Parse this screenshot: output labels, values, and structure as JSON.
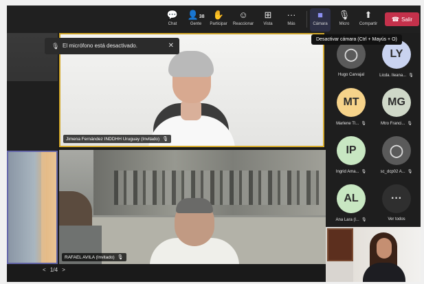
{
  "toolbar": {
    "chat_label": "Chat",
    "people_label": "Gente",
    "people_count": "38",
    "raise_label": "Participar",
    "react_label": "Reaccionar",
    "view_label": "Vista",
    "more_label": "Más",
    "camera_label": "Cámara",
    "mic_label": "Micro",
    "share_label": "Compartir",
    "leave_label": "Salir"
  },
  "tooltip": {
    "text": "Desactivar cámara (Ctrl + Mayús + O)"
  },
  "notice": {
    "text": "El micrófono está desactivado."
  },
  "tiles": {
    "main_name": "Jimena Fernández INDDHH Uruguay (Invitado)",
    "bottom_name": "RAFAEL AVILA (Invitado)"
  },
  "pagination": {
    "prev": "<",
    "page": "1/4",
    "next": ">"
  },
  "participants": [
    {
      "initials": "",
      "name": "Hugo Carvajal",
      "avatar_color": "#5a5a5a",
      "muted": false,
      "icon": "person-icon"
    },
    {
      "initials": "LY",
      "name": "Licda. Ileana...",
      "avatar_color": "#c9d3f0",
      "muted": true
    },
    {
      "initials": "MT",
      "name": "Marlene Tl...",
      "avatar_color": "#f6d38a",
      "muted": true
    },
    {
      "initials": "MG",
      "name": "Mtro Franci...",
      "avatar_color": "#cfd8c8",
      "muted": true
    },
    {
      "initials": "IP",
      "name": "Ingrid Ama...",
      "avatar_color": "#c8e7c2",
      "muted": true
    },
    {
      "initials": "",
      "name": "sc_dcp02 A...",
      "avatar_color": "#5a5a5a",
      "muted": true,
      "icon": "person-icon"
    },
    {
      "initials": "AL",
      "name": "Ana Lara (l...",
      "avatar_color": "#c8e7c2",
      "muted": true
    },
    {
      "initials": "···",
      "name": "Ver todos",
      "avatar_color": "#2f2f2f",
      "muted": false
    }
  ],
  "colors": {
    "accent": "#6264a7",
    "leave": "#c4314b",
    "speaker_border": "#d4a92b"
  }
}
